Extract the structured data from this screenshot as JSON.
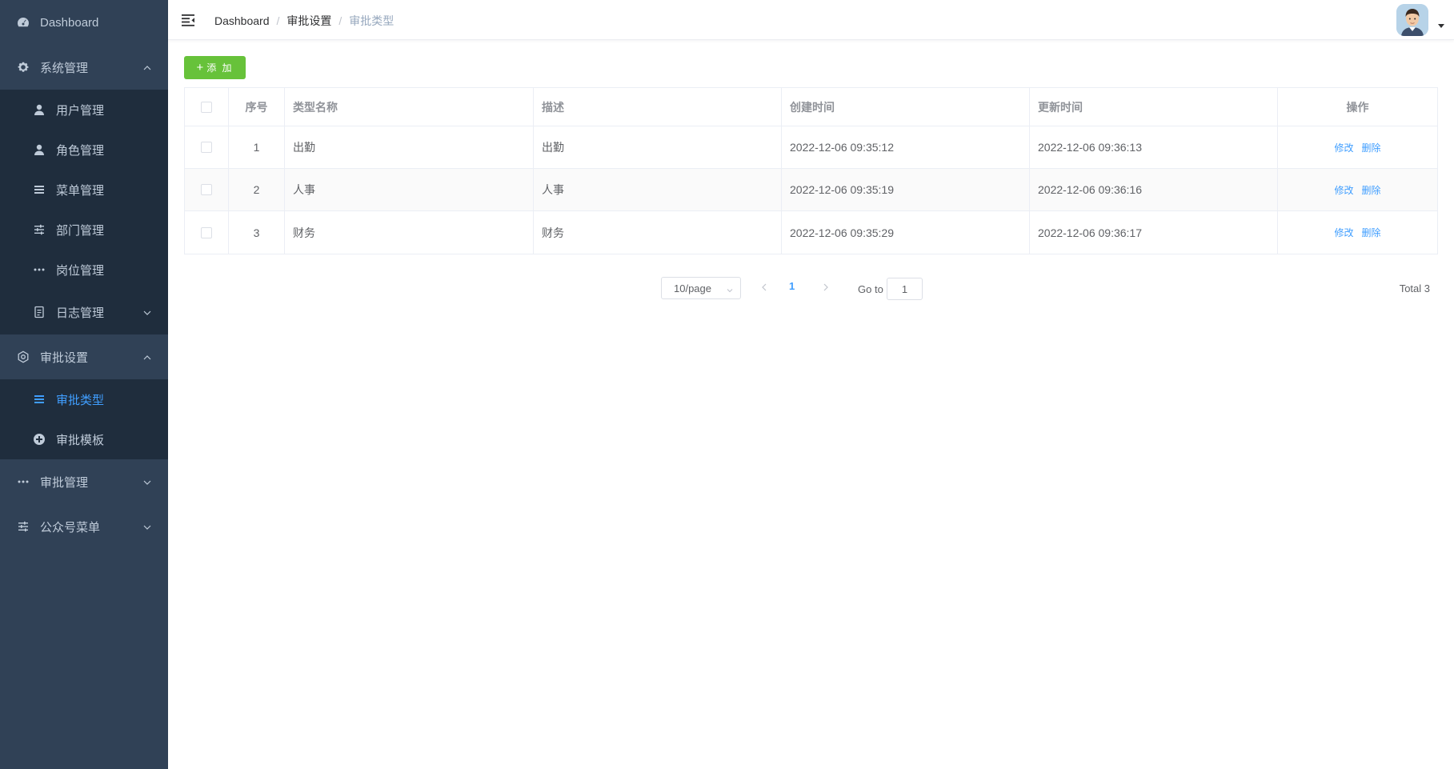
{
  "sidebar": {
    "dashboard": "Dashboard",
    "system": "系统管理",
    "system_children": [
      "用户管理",
      "角色管理",
      "菜单管理",
      "部门管理",
      "岗位管理",
      "日志管理"
    ],
    "approval_settings": "审批设置",
    "approval_settings_children": [
      "审批类型",
      "审批模板"
    ],
    "approval_manage": "审批管理",
    "wechat_menu": "公众号菜单"
  },
  "breadcrumb": [
    "Dashboard",
    "审批设置",
    "审批类型"
  ],
  "toolbar": {
    "add_label": "添 加"
  },
  "table": {
    "columns": [
      "序号",
      "类型名称",
      "描述",
      "创建时间",
      "更新时间",
      "操作"
    ],
    "rows": [
      {
        "index": "1",
        "name": "出勤",
        "desc": "出勤",
        "created": "2022-12-06 09:35:12",
        "updated": "2022-12-06 09:36:13"
      },
      {
        "index": "2",
        "name": "人事",
        "desc": "人事",
        "created": "2022-12-06 09:35:19",
        "updated": "2022-12-06 09:36:16"
      },
      {
        "index": "3",
        "name": "财务",
        "desc": "财务",
        "created": "2022-12-06 09:35:29",
        "updated": "2022-12-06 09:36:17"
      }
    ],
    "ops": {
      "edit": "修改",
      "delete": "删除"
    }
  },
  "pagination": {
    "page_size": "10/page",
    "current_page": "1",
    "goto_label": "Go to",
    "goto_value": "1",
    "total": "Total 3"
  },
  "colors": {
    "sidebar_bg": "#304156",
    "submenu_bg": "#1f2d3d",
    "active": "#409eff",
    "add_button": "#67c23a"
  }
}
